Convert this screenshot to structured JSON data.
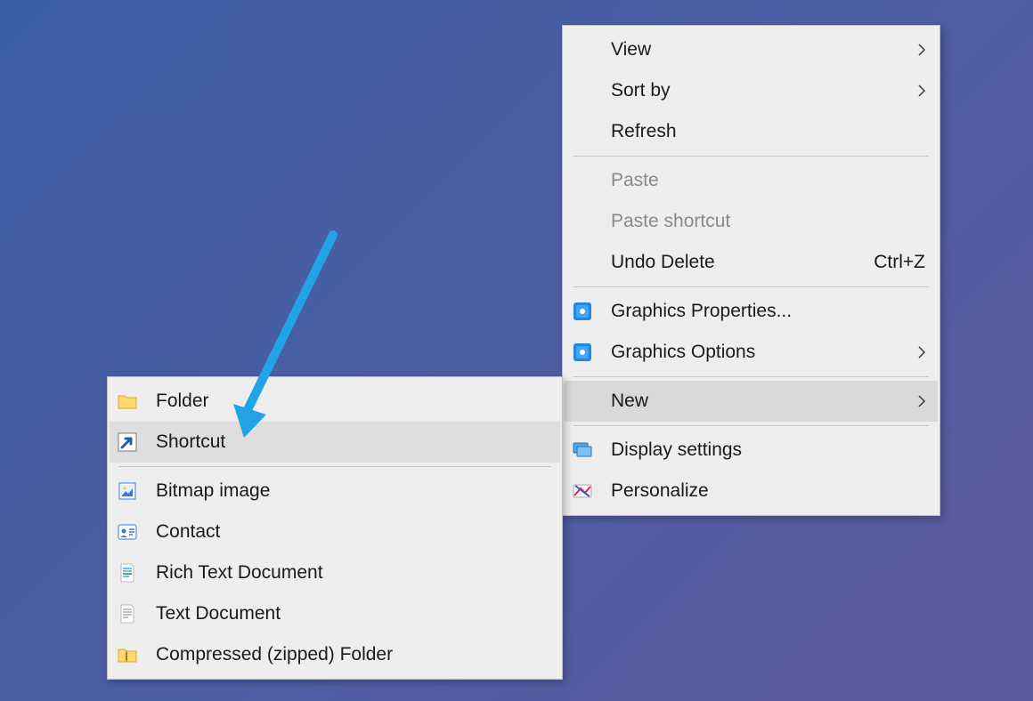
{
  "main_menu": {
    "view": "View",
    "sort_by": "Sort by",
    "refresh": "Refresh",
    "paste": "Paste",
    "paste_shortcut": "Paste shortcut",
    "undo_delete": "Undo Delete",
    "undo_delete_key": "Ctrl+Z",
    "graphics_properties": "Graphics Properties...",
    "graphics_options": "Graphics Options",
    "new": "New",
    "display_settings": "Display settings",
    "personalize": "Personalize"
  },
  "sub_menu": {
    "folder": "Folder",
    "shortcut": "Shortcut",
    "bitmap": "Bitmap image",
    "contact": "Contact",
    "rtf": "Rich Text Document",
    "txt": "Text Document",
    "zip": "Compressed (zipped) Folder"
  }
}
